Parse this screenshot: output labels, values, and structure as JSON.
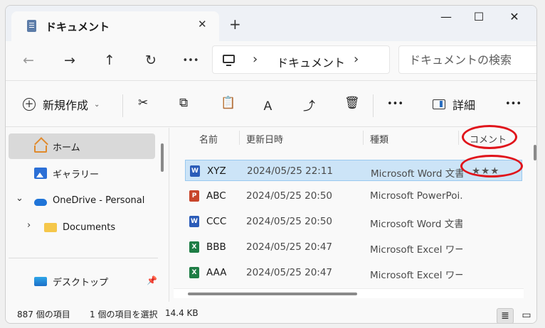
{
  "window": {
    "tab_title": "ドキュメント",
    "close_glyph": "✕",
    "new_tab_glyph": "+",
    "minimize_glyph": "—",
    "maximize_glyph": "☐",
    "close_window_glyph": "✕"
  },
  "nav": {
    "back": "←",
    "forward": "→",
    "up": "↑",
    "refresh": "↻",
    "more": "•••"
  },
  "address": {
    "sep1": "›",
    "crumb": "ドキュメント",
    "sep2": "›"
  },
  "search": {
    "placeholder": "ドキュメントの検索"
  },
  "commands": {
    "new_label": "新規作成",
    "new_caret": "⌄",
    "detail_label": "詳細",
    "more": "•••",
    "cut": "✂",
    "copy": "⧉",
    "paste": "📋",
    "rename": "Ａ",
    "share": "⤴",
    "delete": "🗑"
  },
  "sidebar": {
    "items": [
      {
        "label": "ホーム",
        "icon": "home-icon"
      },
      {
        "label": "ギャラリー",
        "icon": "gallery-icon"
      },
      {
        "label": "OneDrive - Personal",
        "icon": "onedrive-icon"
      },
      {
        "label": "Documents",
        "icon": "folder-icon"
      },
      {
        "label": "デスクトップ",
        "icon": "desktop-icon"
      }
    ],
    "expand_open": "⌄",
    "expand_closed": "›",
    "pin_glyph": "📌"
  },
  "columns": {
    "name": "名前",
    "date": "更新日時",
    "type": "種類",
    "comment": "コメント"
  },
  "files": [
    {
      "name": "XYZ",
      "date": "2024/05/25 22:11",
      "type": "Microsoft Word 文書",
      "comment": "★★★",
      "kind": "W",
      "color": "#2b5cb8"
    },
    {
      "name": "ABC",
      "date": "2024/05/25 20:50",
      "type": "Microsoft PowerPoi...",
      "comment": "",
      "kind": "P",
      "color": "#c8452b"
    },
    {
      "name": "CCC",
      "date": "2024/05/25 20:50",
      "type": "Microsoft Word 文書",
      "comment": "",
      "kind": "W",
      "color": "#2b5cb8"
    },
    {
      "name": "BBB",
      "date": "2024/05/25 20:47",
      "type": "Microsoft Excel ワー...",
      "comment": "",
      "kind": "X",
      "color": "#1e7d45"
    },
    {
      "name": "AAA",
      "date": "2024/05/25 20:47",
      "type": "Microsoft Excel ワー...",
      "comment": "",
      "kind": "X",
      "color": "#1e7d45"
    }
  ],
  "status": {
    "item_count": "887 個の項目",
    "selected": "1 個の項目を選択",
    "size": "14.4 KB",
    "list_view": "≣",
    "tile_view": "▭"
  },
  "colors": {
    "selected_row": "#cce4f7",
    "annotation": "#e0141b",
    "accent": "#2a6ebf"
  }
}
